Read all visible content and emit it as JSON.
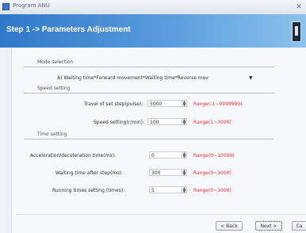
{
  "window": {
    "title": "Program ANU",
    "close_glyph": "✕"
  },
  "header": {
    "title": "Step 1 -> Parameters Adjustment"
  },
  "mode_section": {
    "label": "Mode selection",
    "selected": "A) Waiting time*Forward movement*Waiting time*Reverse mov",
    "caret": "▼"
  },
  "speed_section": {
    "label": "Speed setting",
    "rows": [
      {
        "label": "Travel of set step(pulse):",
        "value": "5000",
        "range": "Range(-1~9999999)"
      },
      {
        "label": "Speed setting(r/min):",
        "value": "100",
        "range": "Range(1~3000)"
      }
    ]
  },
  "time_section": {
    "label": "Time setting",
    "rows": [
      {
        "label": "Acceleration/deceleration time(ms):",
        "value": "0",
        "range": "Range(0~10000)"
      },
      {
        "label": "Waiting time after step(ms):",
        "value": "300",
        "range": "Range(0~1000)"
      },
      {
        "label": "Running times setting (times):",
        "value": "5",
        "range": "Range(0~1000)"
      }
    ]
  },
  "footer": {
    "back": "< Back",
    "next": "Next >",
    "cancel": "Ca"
  },
  "colors": {
    "header_start": "#2f77c9",
    "header_end": "#8cc2ec",
    "range_text": "#e24040"
  }
}
